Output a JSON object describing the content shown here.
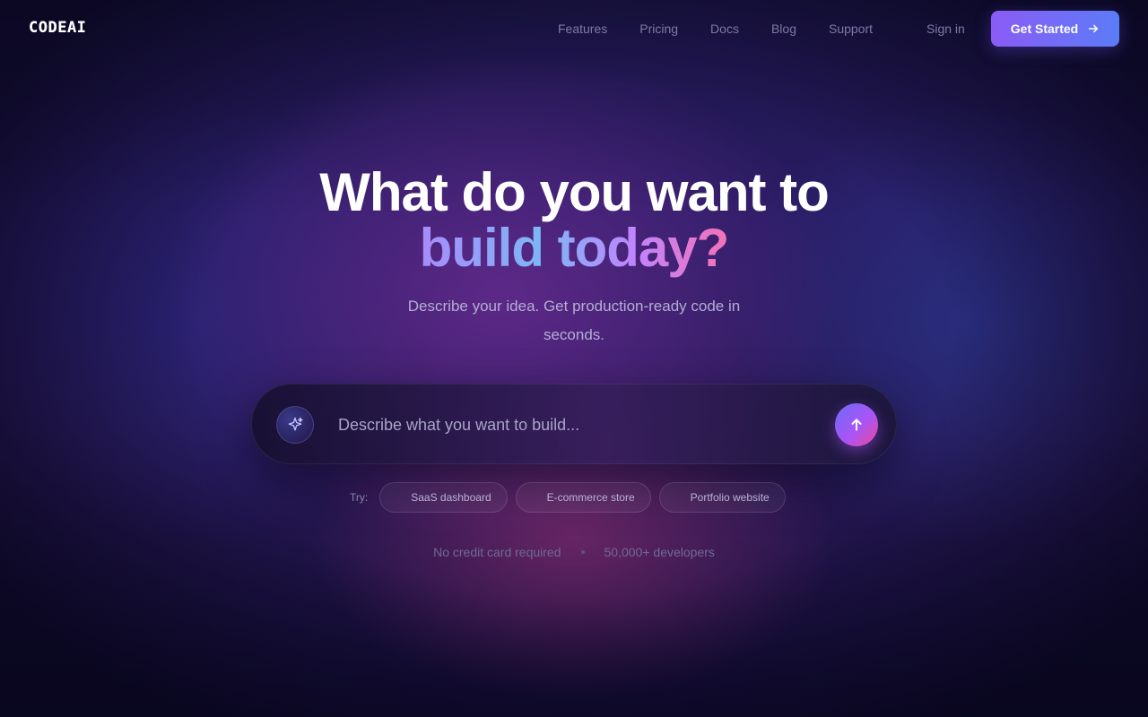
{
  "brand": {
    "logo_text": "CODEAI"
  },
  "nav": {
    "links": [
      "Features",
      "Pricing",
      "Docs",
      "Blog",
      "Support"
    ],
    "sign_in": "Sign in",
    "cta_label": "Get Started",
    "cta_icon": "arrow-right-icon"
  },
  "hero": {
    "title_line1": "What do you want to",
    "title_line2": "build today?",
    "subtitle": "Describe your idea. Get production-ready code in seconds."
  },
  "prompt": {
    "placeholder": "Describe what you want to build...",
    "leading_icon": "sparkles-icon",
    "send_icon": "arrow-up-icon"
  },
  "suggestions": {
    "label": "Try:",
    "chips": [
      "SaaS dashboard",
      "E-commerce store",
      "Portfolio website"
    ]
  },
  "footnote": {
    "items": [
      "No credit card required",
      "50,000+ developers"
    ]
  },
  "colors": {
    "accent_start": "#8b5cf6",
    "accent_end": "#5b7cf7",
    "background": "#1c1548"
  }
}
